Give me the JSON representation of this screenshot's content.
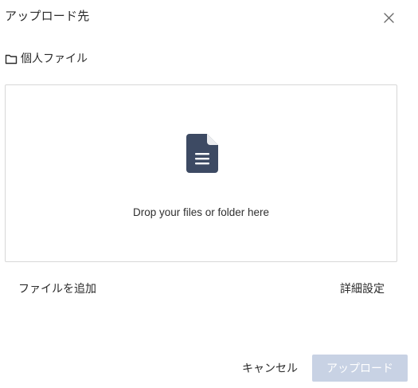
{
  "dialog": {
    "title": "アップロード先",
    "close_icon": "close-icon"
  },
  "destination": {
    "icon": "folder-icon",
    "label": "個人ファイル"
  },
  "dropzone": {
    "icon": "document-icon",
    "text": "Drop your files or folder here"
  },
  "actions": {
    "add_files": "ファイルを追加",
    "advanced_settings": "詳細設定"
  },
  "footer": {
    "cancel_label": "キャンセル",
    "upload_label": "アップロード"
  },
  "colors": {
    "icon_fill": "#3d4a63",
    "upload_button_bg": "#c8d2e4",
    "border": "#d7d7d7"
  }
}
